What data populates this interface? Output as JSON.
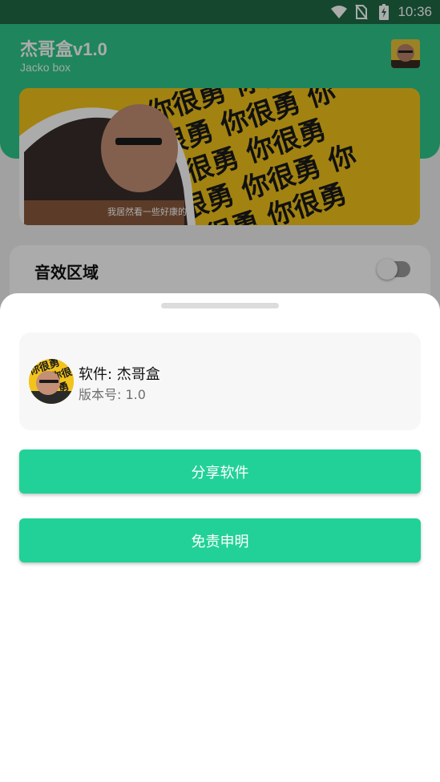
{
  "status_bar": {
    "time": "10:36",
    "icons": [
      "wifi-icon",
      "no-sim-icon",
      "battery-charging-icon"
    ]
  },
  "app": {
    "title": "杰哥盒v1.0",
    "subtitle": "Jacko box",
    "avatar_icon": "user-avatar",
    "banner": {
      "pattern_text": "你很勇",
      "caption": "我居然看一些好康的"
    },
    "sound_section": {
      "label": "音效区域",
      "toggle_on": false
    }
  },
  "sheet": {
    "software_name": "软件: 杰哥盒",
    "version": "版本号: 1.0",
    "share_button": "分享软件",
    "disclaimer_button": "免责申明"
  },
  "colors": {
    "primary_green": "#22d197",
    "header_green": "#2fc789",
    "status_bar": "#1f6b45",
    "banner_yellow": "#f2c31a"
  }
}
